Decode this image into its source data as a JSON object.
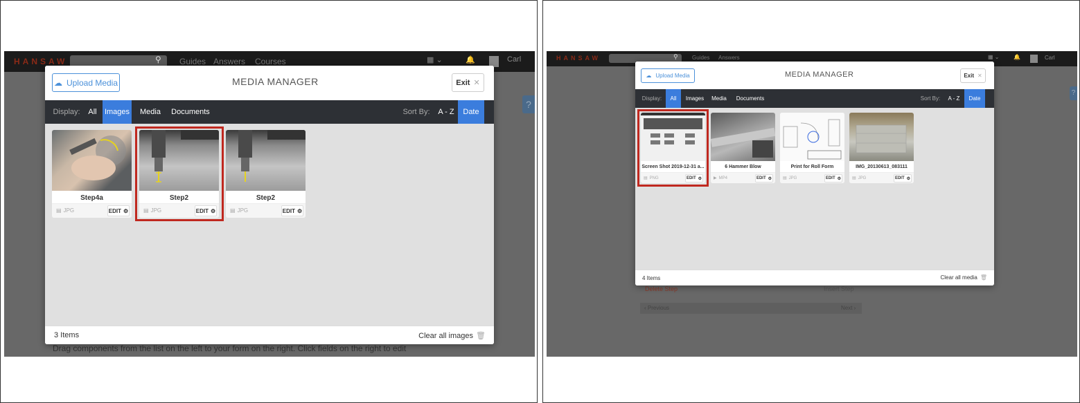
{
  "left": {
    "topbar": {
      "logo": "HANSAW",
      "nav": [
        "Guides",
        "Answers",
        "Courses"
      ],
      "user": "Carl"
    },
    "behind_text": "Drag components from the list on the left to your form on the right. Click fields on the right to edit",
    "modal": {
      "upload_label": "Upload Media",
      "title": "MEDIA MANAGER",
      "exit_label": "Exit",
      "display_label": "Display:",
      "filters": [
        "All",
        "Images",
        "Media",
        "Documents"
      ],
      "active_filter": "Images",
      "sort_label": "Sort By:",
      "sort_options": [
        "A - Z",
        "Date"
      ],
      "active_sort": "Date",
      "items": [
        {
          "name": "Step4a",
          "type": "JPG",
          "edit": "EDIT"
        },
        {
          "name": "Step2",
          "type": "JPG",
          "edit": "EDIT"
        },
        {
          "name": "Step2",
          "type": "JPG",
          "edit": "EDIT"
        }
      ],
      "count": "3 Items",
      "clear_label": "Clear all images"
    }
  },
  "right": {
    "topbar": {
      "logo": "HANSAW",
      "nav": [
        "Guides",
        "Answers"
      ],
      "user": "Carl"
    },
    "behind": {
      "delete_step": "Delete Step",
      "insert_step": "Insert Step",
      "previous": "‹ Previous",
      "next": "Next ›"
    },
    "modal": {
      "upload_label": "Upload Media",
      "title": "MEDIA MANAGER",
      "exit_label": "Exit",
      "display_label": "Display:",
      "filters": [
        "All",
        "Images",
        "Media",
        "Documents"
      ],
      "active_filter": "All",
      "sort_label": "Sort By:",
      "sort_options": [
        "A - Z",
        "Date"
      ],
      "active_sort": "Date",
      "items": [
        {
          "name": "Screen Shot 2019-12-31 a...",
          "type": "PNG",
          "edit": "EDIT"
        },
        {
          "name": "6 Hammer Blow",
          "type": "MP4",
          "edit": "EDIT"
        },
        {
          "name": "Print for Roll Form",
          "type": "JPG",
          "edit": "EDIT"
        },
        {
          "name": "IMG_20130613_083111",
          "type": "JPG",
          "edit": "EDIT"
        }
      ],
      "count": "4 Items",
      "clear_label": "Clear all media"
    }
  }
}
